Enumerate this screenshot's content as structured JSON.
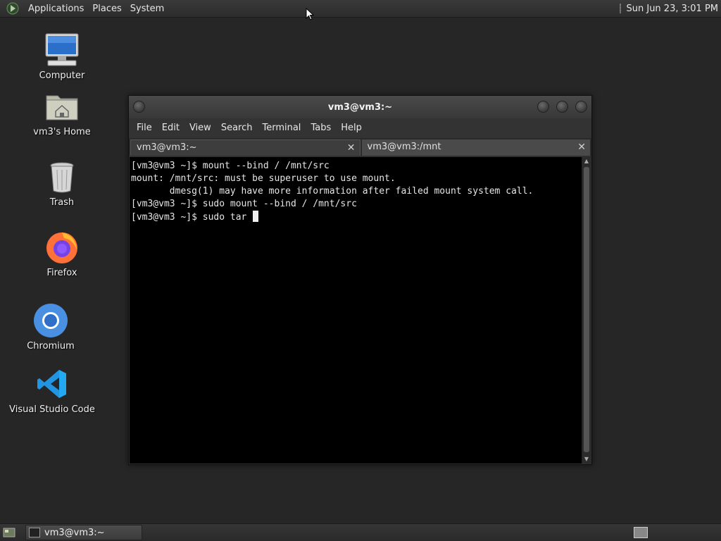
{
  "top_panel": {
    "menus": [
      "Applications",
      "Places",
      "System"
    ],
    "clock": "Sun Jun 23,  3:01 PM"
  },
  "desktop": {
    "icons": [
      {
        "label": "Computer",
        "icon": "computer-icon"
      },
      {
        "label": "vm3's Home",
        "icon": "home-folder-icon"
      },
      {
        "label": "Trash",
        "icon": "trash-icon"
      },
      {
        "label": "Firefox",
        "icon": "firefox-icon"
      },
      {
        "label": "Chromium",
        "icon": "chromium-icon"
      },
      {
        "label": "Visual Studio Code",
        "icon": "vscode-icon"
      }
    ]
  },
  "terminal": {
    "title": "vm3@vm3:~",
    "menu": [
      "File",
      "Edit",
      "View",
      "Search",
      "Terminal",
      "Tabs",
      "Help"
    ],
    "tabs": [
      {
        "label": "vm3@vm3:~",
        "active": true
      },
      {
        "label": "vm3@vm3:/mnt",
        "active": false
      }
    ],
    "lines": [
      "[vm3@vm3 ~]$ mount --bind / /mnt/src",
      "mount: /mnt/src: must be superuser to use mount.",
      "       dmesg(1) may have more information after failed mount system call.",
      "[vm3@vm3 ~]$ sudo mount --bind / /mnt/src",
      "[vm3@vm3 ~]$ sudo tar "
    ]
  },
  "taskbar": {
    "window_button": "vm3@vm3:~"
  },
  "colors": {
    "desktop_bg": "#262626",
    "terminal_bg": "#000000",
    "firefox_orange": "#ff7139",
    "chromium_blue": "#4a90e2",
    "vscode_blue": "#23a9f2"
  }
}
